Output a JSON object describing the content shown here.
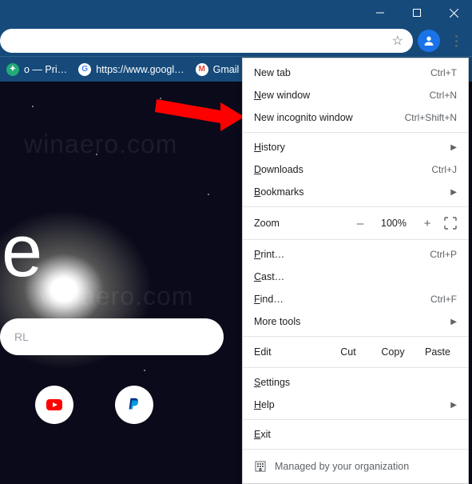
{
  "titlebar": {},
  "bookmarks": {
    "items": [
      {
        "label": "o — Pri…"
      },
      {
        "label": "https://www.googl…"
      },
      {
        "label": "Gmail"
      }
    ]
  },
  "page": {
    "logo_text": "oogle",
    "search_placeholder": "RL",
    "watermark1": "winaero.com",
    "watermark2": "winaero.com"
  },
  "menu": {
    "new_tab": "New tab",
    "new_tab_k": "Ctrl+T",
    "new_window": "ew window",
    "new_window_pre": "N",
    "new_window_k": "Ctrl+N",
    "incognito": "New incognito window",
    "incognito_k": "Ctrl+Shift+N",
    "history": "istory",
    "history_pre": "H",
    "downloads": "ownloads",
    "downloads_pre": "D",
    "downloads_k": "Ctrl+J",
    "bookmarks": "ookmarks",
    "bookmarks_pre": "B",
    "zoom": "Zoom",
    "zoom_val": "100%",
    "print": "rint…",
    "print_pre": "P",
    "print_k": "Ctrl+P",
    "cast": "ast…",
    "cast_pre": "C",
    "find": "ind…",
    "find_pre": "F",
    "find_k": "Ctrl+F",
    "more_tools": "More tools",
    "edit": "Edit",
    "cut": "Cut",
    "copy": "Copy",
    "paste": "Paste",
    "settings": "ettings",
    "settings_pre": "S",
    "help": "elp",
    "help_pre": "H",
    "exit": "xit",
    "exit_pre": "E",
    "managed": "Managed by your organization"
  }
}
